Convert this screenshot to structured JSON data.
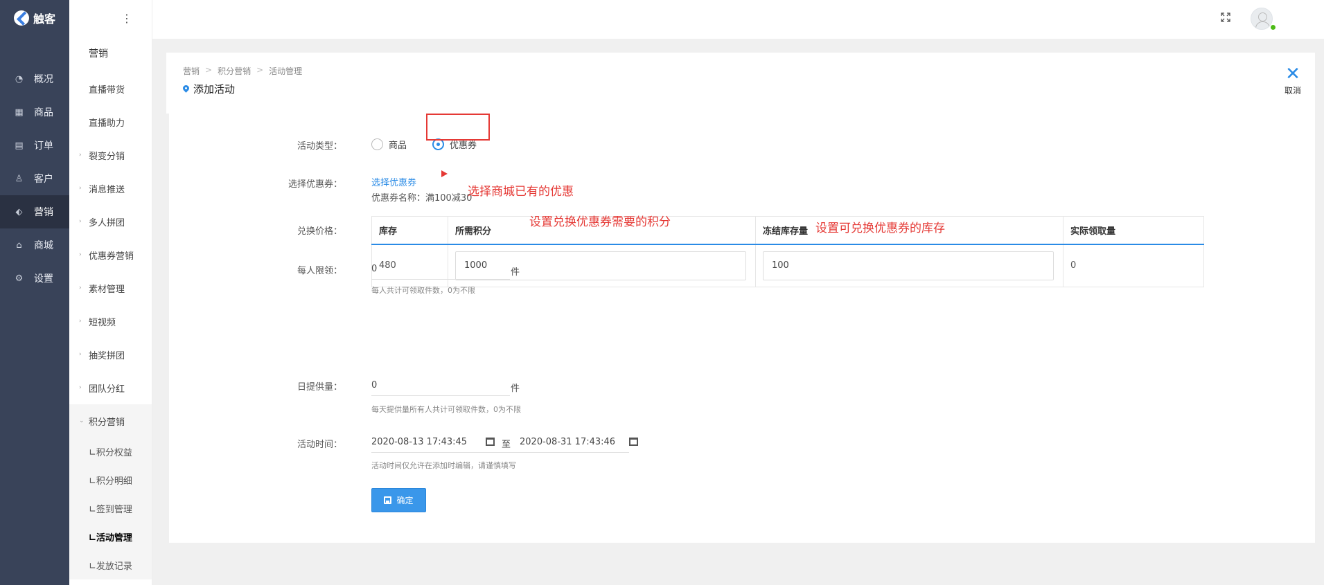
{
  "brand": {
    "name": "触客"
  },
  "main_nav": [
    {
      "label": "概况",
      "icon": "dashboard-icon",
      "active": false
    },
    {
      "label": "商品",
      "icon": "grid-icon",
      "active": false
    },
    {
      "label": "订单",
      "icon": "calendar-icon",
      "active": false
    },
    {
      "label": "客户",
      "icon": "user-icon",
      "active": false
    },
    {
      "label": "营销",
      "icon": "tag-icon",
      "active": true
    },
    {
      "label": "商城",
      "icon": "store-icon",
      "active": false
    },
    {
      "label": "设置",
      "icon": "gear-icon",
      "active": false
    }
  ],
  "sub_nav": {
    "title": "营销",
    "items": [
      "直播带货",
      "直播助力",
      "裂变分销",
      "消息推送",
      "多人拼团",
      "优惠券营销",
      "素材管理",
      "短视频",
      "抽奖拼团",
      "团队分红",
      "积分营销"
    ],
    "expandable": [
      false,
      false,
      true,
      true,
      true,
      true,
      true,
      true,
      true,
      true,
      true
    ],
    "children": [
      "∟积分权益",
      "∟积分明细",
      "∟签到管理",
      "∟活动管理",
      "∟发放记录"
    ]
  },
  "breadcrumb": [
    "营销",
    "积分营销",
    "活动管理"
  ],
  "page": {
    "title": "添加活动",
    "cancel_label": "取消"
  },
  "form": {
    "activity_type": {
      "label": "活动类型：",
      "options": [
        "商品",
        "优惠券"
      ],
      "selected": "优惠券"
    },
    "coupon": {
      "label": "选择优惠券：",
      "link": "选择优惠券",
      "name": "优惠券名称：满100减30"
    },
    "price": {
      "label": "兑换价格：",
      "columns": [
        "库存",
        "所需积分",
        "冻结库存量",
        "实际领取量"
      ],
      "row": {
        "stock": "480",
        "points": "1000",
        "frozen": "100",
        "claimed": "0"
      }
    },
    "per_person": {
      "label": "每人限领：",
      "value": "0",
      "unit": "件",
      "hint": "每人共计可领取件数，0为不限"
    },
    "daily": {
      "label": "日提供量：",
      "value": "0",
      "unit": "件",
      "hint": "每天提供量所有人共计可领取件数，0为不限"
    },
    "time": {
      "label": "活动时间：",
      "start": "2020-08-13 17:43:45",
      "sep": "至",
      "end": "2020-08-31 17:43:46",
      "hint": "活动时间仅允许在添加时编辑，请谨慎填写"
    },
    "submit": "确定"
  },
  "annotations": {
    "coupon_note": "选择商城已有的优惠",
    "points_note": "设置兑换优惠券需要的积分",
    "stock_note": "设置可兑换优惠券的库存"
  },
  "colors": {
    "accent": "#2a8be6",
    "sidebar": "#394359",
    "annotation": "#e53935"
  }
}
